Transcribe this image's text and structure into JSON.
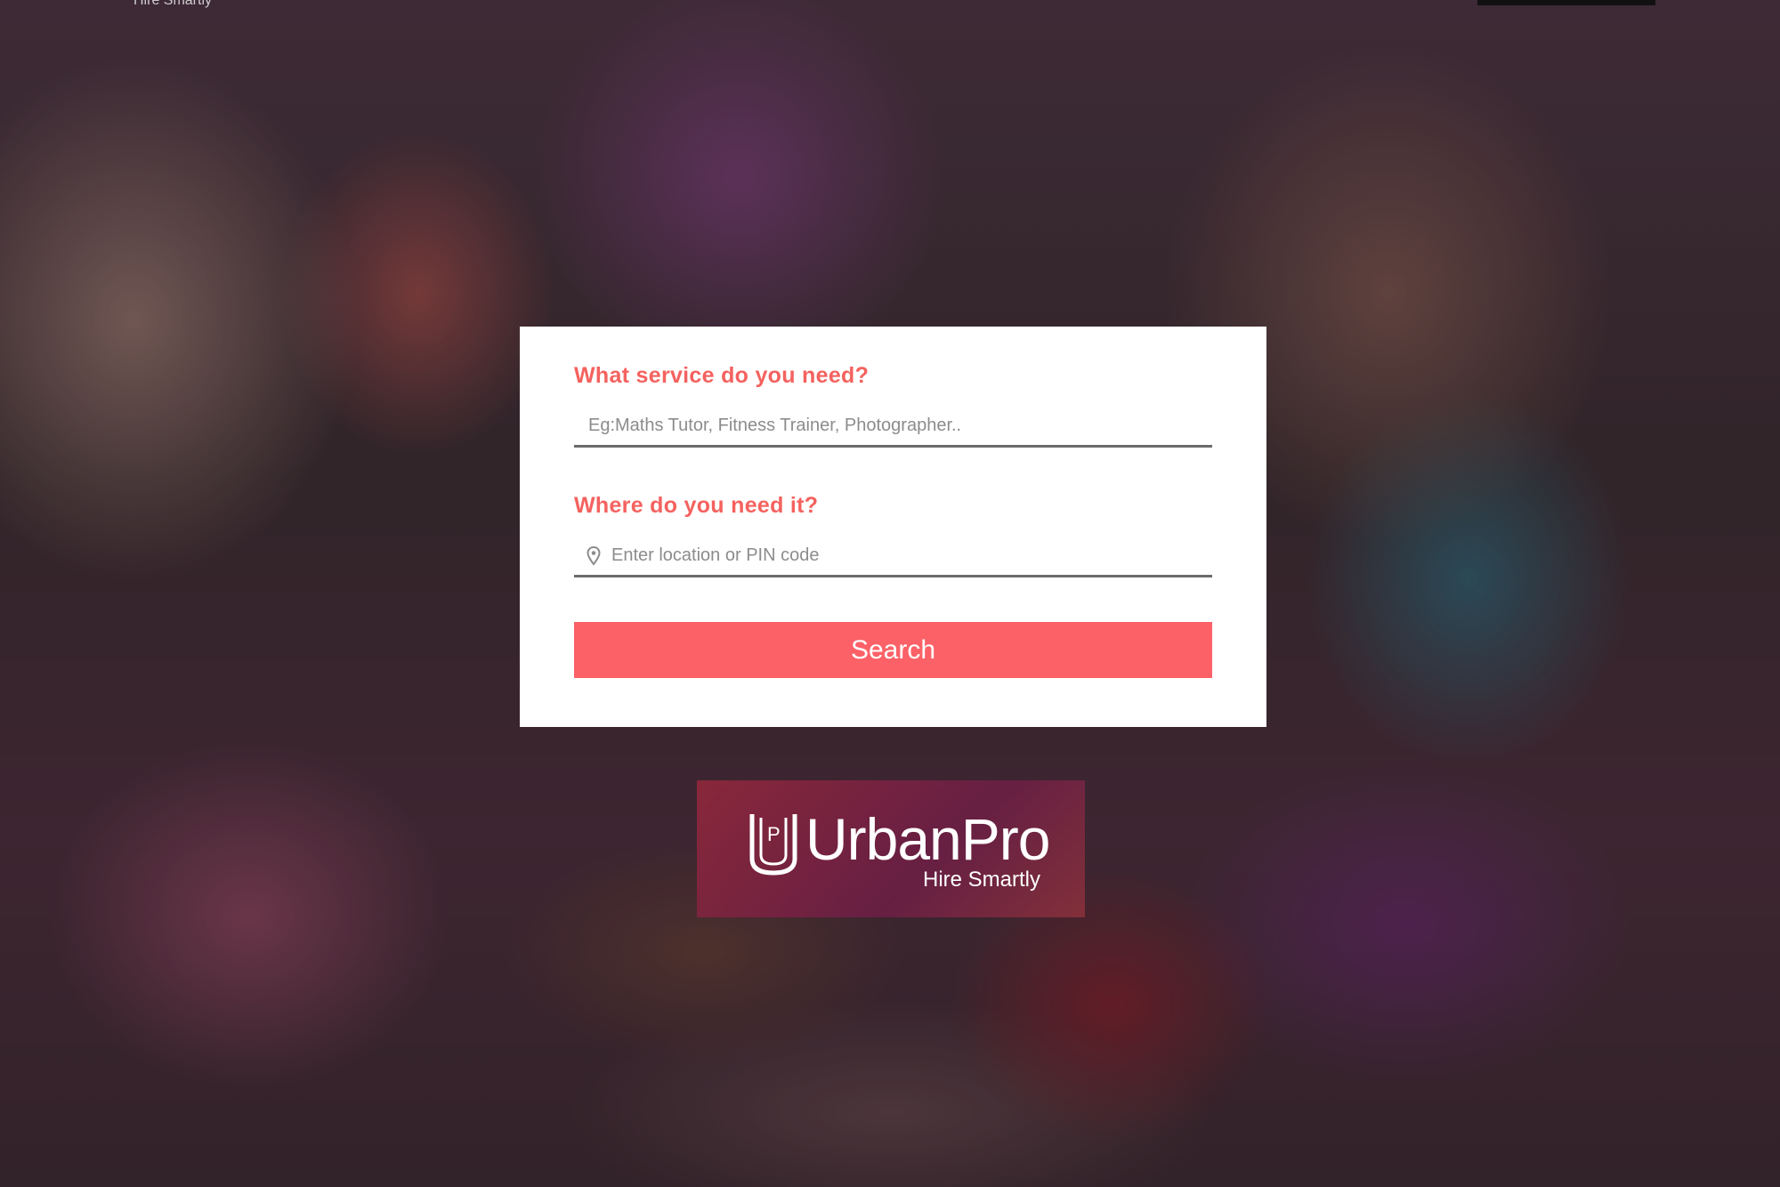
{
  "header": {
    "partial_tagline": "Hire Smartly"
  },
  "search_form": {
    "service_label": "What service do you need?",
    "service_placeholder": "Eg:Maths Tutor, Fitness Trainer, Photographer..",
    "location_label": "Where do you need it?",
    "location_placeholder": "Enter location or PIN code",
    "location_icon": "map-pin-icon",
    "search_button": "Search"
  },
  "logo": {
    "name": "UrbanPro",
    "tagline": "Hire Smartly",
    "mark_letter": "P"
  },
  "colors": {
    "accent": "#f4625f",
    "button": "#fb6167",
    "card_bg": "#ffffff"
  }
}
